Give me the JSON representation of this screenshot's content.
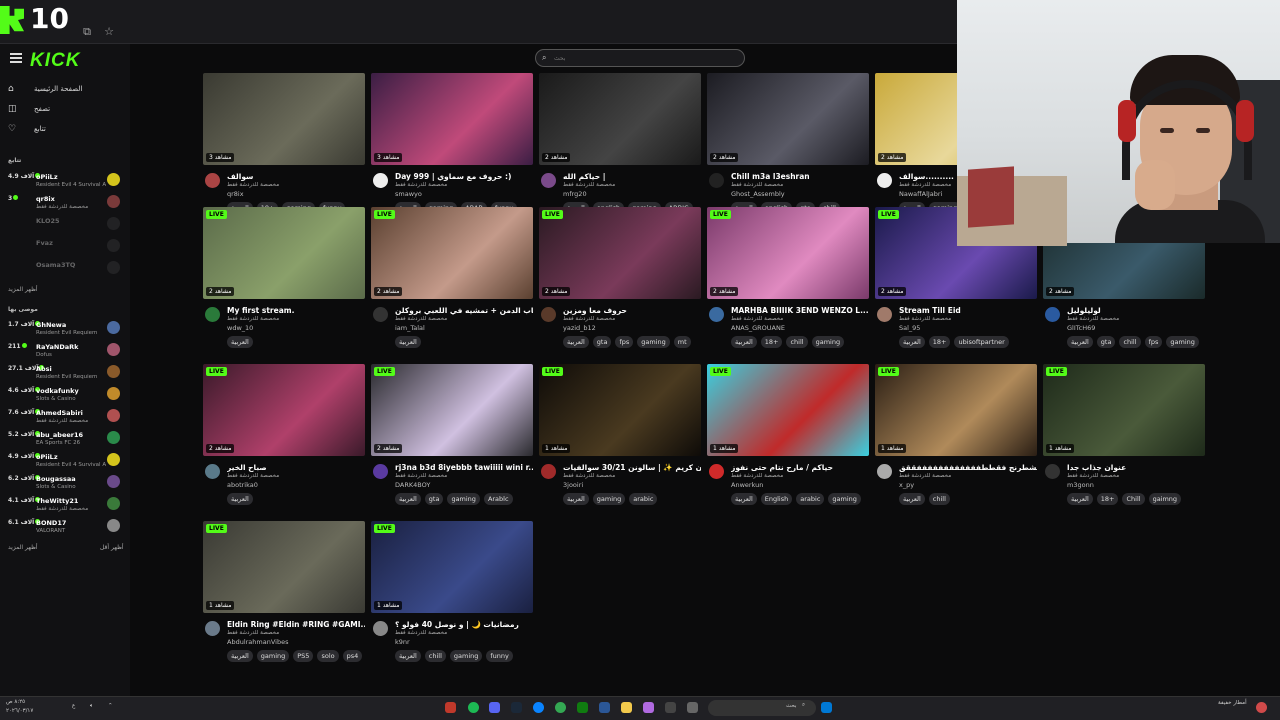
{
  "browser": {
    "tab_count": "10"
  },
  "sidebar": {
    "logo": "KICK",
    "nav": [
      {
        "label": "الصفحة الرئيسية",
        "icon": "home-icon"
      },
      {
        "label": "تصفح",
        "icon": "browse-icon"
      },
      {
        "label": "تتابع",
        "icon": "heart-icon"
      }
    ],
    "following_header": "تتابع",
    "following": [
      {
        "count": "4.9 آلاف",
        "name": "oPiiLz",
        "category": "Resident Evil 4 Survival Ascended",
        "online": true,
        "avatar": "#d4c41c"
      },
      {
        "count": "3",
        "name": "qr8ix",
        "category": "مخصصة للدردشة فقط",
        "online": true,
        "avatar": "#7a3a3a"
      },
      {
        "count": "",
        "name": "KLO25",
        "category": "",
        "online": false,
        "avatar": "#444"
      },
      {
        "count": "",
        "name": "Fvaz",
        "category": "",
        "online": false,
        "avatar": "#444"
      },
      {
        "count": "",
        "name": "Osama3TQ",
        "category": "",
        "online": false,
        "avatar": "#444"
      }
    ],
    "show_more_1": "أظهر المزيد",
    "recommended_header": "موصى بها",
    "recommended": [
      {
        "count": "1.7 آلاف",
        "name": "GhNewa",
        "category": "Resident Evil Requiem",
        "avatar": "#4b6aa0"
      },
      {
        "count": "211",
        "name": "RaYaNDaRk",
        "category": "Dofus",
        "avatar": "#a0556b"
      },
      {
        "count": "27.1 آلاف",
        "name": "Absi",
        "category": "Resident Evil Requiem",
        "avatar": "#8a5a2a"
      },
      {
        "count": "4.6 آلاف",
        "name": "vodkafunky",
        "category": "Slots & Casino",
        "avatar": "#c08a2a"
      },
      {
        "count": "7.6 آلاف",
        "name": "AhmedSabiri",
        "category": "مخصصة للدردشة فقط",
        "avatar": "#b05050"
      },
      {
        "count": "5.2 آلاف",
        "name": "abu_abeer16",
        "category": "EA Sports FC 26",
        "avatar": "#2a8a4a"
      },
      {
        "count": "4.9 آلاف",
        "name": "oPiiLz",
        "category": "Resident Evil 4 Survival Ascended",
        "avatar": "#d4c41c"
      },
      {
        "count": "6.2 آلاف",
        "name": "Bougassaa",
        "category": "Slots & Casino",
        "avatar": "#6a4a8a"
      },
      {
        "count": "4.1 آلاف",
        "name": "TheWitty21",
        "category": "مخصصة للدردشة فقط",
        "avatar": "#3a7a3a"
      },
      {
        "count": "6.1 آلاف",
        "name": "BOND17",
        "category": "VALORANT",
        "avatar": "#888"
      }
    ],
    "show_more_2": "أظهر المزيد",
    "show_less": "أظهر أقل"
  },
  "search": {
    "placeholder": "بحث"
  },
  "streams": [
    {
      "title": "سوالف",
      "user": "qr8ix",
      "views": "3 مشاهد",
      "live": false,
      "tags": [
        "العربية",
        "18+",
        "gaming",
        "funny"
      ],
      "thumb": "#3a3a32",
      "thumb2": "#6b6b5a",
      "avatar": "#a44"
    },
    {
      "title": "Day 999 | حروف مع سماوي :)",
      "user": "smawyo",
      "views": "3 مشاهد",
      "live": false,
      "tags": [
        "العربية",
        "gaming",
        "ARAB",
        "funny"
      ],
      "thumb": "#3b1e44",
      "thumb2": "#c04a7a",
      "avatar": "#eee"
    },
    {
      "title": "حياكم الله |",
      "user": "mfrg20",
      "views": "2 مشاهد",
      "live": false,
      "tags": [
        "العربية",
        "english",
        "gaming",
        "ARBIC"
      ],
      "thumb": "#1a1a1a",
      "thumb2": "#444",
      "avatar": "#7a4a8a"
    },
    {
      "title": "Chill m3a l3eshran",
      "user": "Ghost_Assembly",
      "views": "2 مشاهد",
      "live": false,
      "tags": [
        "العربية",
        "english",
        "gta",
        "chill"
      ],
      "thumb": "#1c1c22",
      "thumb2": "#5a5a66",
      "avatar": "#222"
    },
    {
      "title": "سوالف..........",
      "user": "NawaffAlJabri",
      "views": "2 مشاهد",
      "live": false,
      "tags": [
        "العربية",
        "gaming"
      ],
      "thumb": "#c9a93a",
      "thumb2": "#e8d89a",
      "avatar": "#eee"
    },
    {
      "title": "My first stream.",
      "user": "wdw_10",
      "views": "2 مشاهد",
      "live": true,
      "tags": [
        "العربية"
      ],
      "thumb": "#5b6b4a",
      "thumb2": "#8aa06a",
      "avatar": "#2a7a3a"
    },
    {
      "title": "مع الشباب الدمن + تمشيه في اللعبي بروكلن ...",
      "user": "iam_Talal",
      "views": "2 مشاهد",
      "live": true,
      "tags": [
        "العربية"
      ],
      "thumb": "#5a4030",
      "thumb2": "#c49a8a",
      "avatar": "#333"
    },
    {
      "title": "حروف معا ومزين",
      "user": "yazid_b12",
      "views": "2 مشاهد",
      "live": true,
      "tags": [
        "العربية",
        "gta",
        "fps",
        "gaming",
        "mt"
      ],
      "thumb": "#2a1a22",
      "thumb2": "#7a3a5a",
      "avatar": "#5a3a2a"
    },
    {
      "title": "MARHBA BIIIIK 3END WENZO L...",
      "user": "ANAS_GROUANE",
      "views": "2 مشاهد",
      "live": true,
      "tags": [
        "العربية",
        "18+",
        "chill",
        "gaming"
      ],
      "thumb": "#7a3a6a",
      "thumb2": "#e08ac0",
      "avatar": "#3a6aa0"
    },
    {
      "title": "Stream Till Eid",
      "user": "Sal_95",
      "views": "2 مشاهد",
      "live": true,
      "tags": [
        "العربية",
        "18+",
        "ubisoftpartner"
      ],
      "thumb": "#1a1a4a",
      "thumb2": "#6a4ab0",
      "avatar": "#a07a6a"
    },
    {
      "title": "لوليلوليل",
      "user": "GlITcH69",
      "views": "2 مشاهد",
      "live": true,
      "tags": [
        "العربية",
        "gta",
        "chill",
        "fps",
        "gaming"
      ],
      "thumb": "#1a2a2a",
      "thumb2": "#3a5a6a",
      "avatar": "#2a5aa0"
    },
    {
      "title": "صباح الخير",
      "user": "abotrika0",
      "views": "2 مشاهد",
      "live": true,
      "tags": [
        "العربية"
      ],
      "thumb": "#3a1a2a",
      "thumb2": "#b0406a",
      "avatar": "#5a7a8a"
    },
    {
      "title": "rj3na b3d 8iyebbb tawiiiii wini r...",
      "user": "DARK4BOY",
      "views": "2 مشاهد",
      "live": true,
      "tags": [
        "العربية",
        "gta",
        "gaming",
        "Arablc"
      ],
      "thumb": "#2a2a2e",
      "thumb2": "#d0c0e0",
      "avatar": "#5a3aa0"
    },
    {
      "title": "رمضان كريم ✨ | سالونن 30/21 سوالفيات ...",
      "user": "3jooiri",
      "views": "1 مشاهد",
      "live": true,
      "tags": [
        "العربية",
        "gaming",
        "arabic"
      ],
      "thumb": "#0e0b08",
      "thumb2": "#4a3a20",
      "avatar": "#a02a2a"
    },
    {
      "title": "حياكم / مارح نتام حتى نفوز",
      "user": "Anwerkun",
      "views": "1 مشاهد",
      "live": true,
      "tags": [
        "العربية",
        "English",
        "arabic",
        "gaming"
      ],
      "thumb": "#3ad0e0",
      "thumb2": "#c02a2a",
      "avatar": "#d02a2a"
    },
    {
      "title": "ااااالشطرنج فقططففففففففففففققق",
      "user": "x_py",
      "views": "1 مشاهد",
      "live": true,
      "tags": [
        "العربية",
        "chill"
      ],
      "thumb": "#2a1e14",
      "thumb2": "#b08a5a",
      "avatar": "#aaa"
    },
    {
      "title": "عنوان جذاب جدا",
      "user": "m3gonn",
      "views": "1 مشاهد",
      "live": true,
      "tags": [
        "العربية",
        "18+",
        "Chill",
        "gaimng"
      ],
      "thumb": "#1e2a1a",
      "thumb2": "#4a5a3a",
      "avatar": "#333"
    },
    {
      "title": "Eldin Ring #Eldin #RING #GAMI...",
      "user": "AbdulrahmanVibes",
      "views": "1 مشاهد",
      "live": true,
      "tags": [
        "العربية",
        "gaming",
        "PS5",
        "solo",
        "ps4"
      ],
      "thumb": "#3a3a34",
      "thumb2": "#6a6a5a",
      "avatar": "#6a7a8a"
    },
    {
      "title": "رمضانيات 🌙 | و نوصل 40 فولو ؟",
      "user": "k9nr",
      "views": "1 مشاهد",
      "live": true,
      "tags": [
        "العربية",
        "chill",
        "gaming",
        "funny"
      ],
      "thumb": "#1a2040",
      "thumb2": "#3a4a8a",
      "avatar": "#888"
    }
  ],
  "card_subtitle": "مخصصة للدردشة فقط",
  "live_label": "LIVE",
  "taskbar": {
    "search_label": "بحث",
    "weather": "أمطار خفيفة",
    "clock": "٨:٢٥ ص",
    "date": "٢٠٢٦/٠٣/١٧"
  }
}
